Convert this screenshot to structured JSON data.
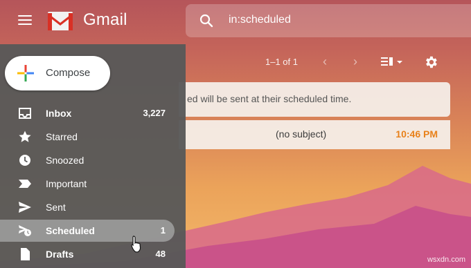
{
  "app": {
    "brand": "Gmail"
  },
  "search": {
    "query": "in:scheduled"
  },
  "toolbar": {
    "pager": "1–1 of 1"
  },
  "info": {
    "text": "ed will be sent at their scheduled time."
  },
  "mail": {
    "subject": "(no subject)",
    "time": "10:46 PM"
  },
  "compose": {
    "label": "Compose"
  },
  "sidebar": {
    "items": [
      {
        "label": "Inbox",
        "count": "3,227",
        "icon": "inbox-icon",
        "bold": true
      },
      {
        "label": "Starred",
        "count": "",
        "icon": "star-icon",
        "bold": false
      },
      {
        "label": "Snoozed",
        "count": "",
        "icon": "clock-icon",
        "bold": false
      },
      {
        "label": "Important",
        "count": "",
        "icon": "important-icon",
        "bold": false
      },
      {
        "label": "Sent",
        "count": "",
        "icon": "send-icon",
        "bold": false
      },
      {
        "label": "Scheduled",
        "count": "1",
        "icon": "scheduled-icon",
        "bold": true
      },
      {
        "label": "Drafts",
        "count": "48",
        "icon": "draft-icon",
        "bold": true
      }
    ]
  },
  "watermark": "wsxdn.com",
  "colors": {
    "accent_time": "#e8811a",
    "sidebar_bg": "#585858"
  }
}
